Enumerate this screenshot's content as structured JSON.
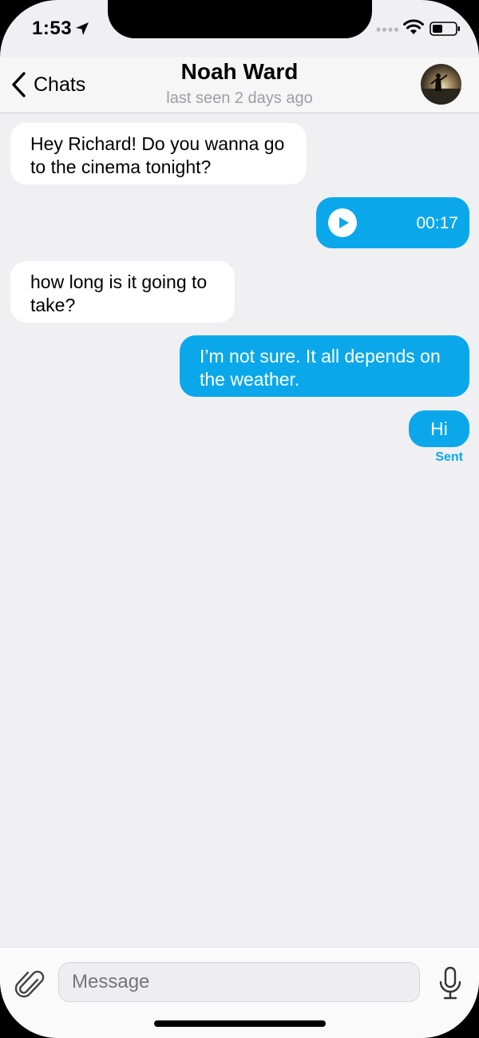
{
  "status_bar": {
    "time": "1:53"
  },
  "header": {
    "back_label": "Chats",
    "contact_name": "Noah Ward",
    "last_seen": "last seen 2 days ago"
  },
  "messages": [
    {
      "direction": "incoming",
      "type": "text",
      "text": "Hey Richard! Do you wanna go to the cinema tonight?"
    },
    {
      "direction": "outgoing",
      "type": "voice",
      "duration": "00:17"
    },
    {
      "direction": "incoming",
      "type": "text",
      "text": "how long is it going to take?"
    },
    {
      "direction": "outgoing",
      "type": "text",
      "text": "I’m not sure. It all depends on the weather."
    },
    {
      "direction": "outgoing",
      "type": "text",
      "text": "Hi",
      "status": "Sent"
    }
  ],
  "composer": {
    "placeholder": "Message"
  },
  "colors": {
    "accent": "#0aa8ea",
    "background": "#f0eff2",
    "incoming_bubble": "#ffffff"
  }
}
